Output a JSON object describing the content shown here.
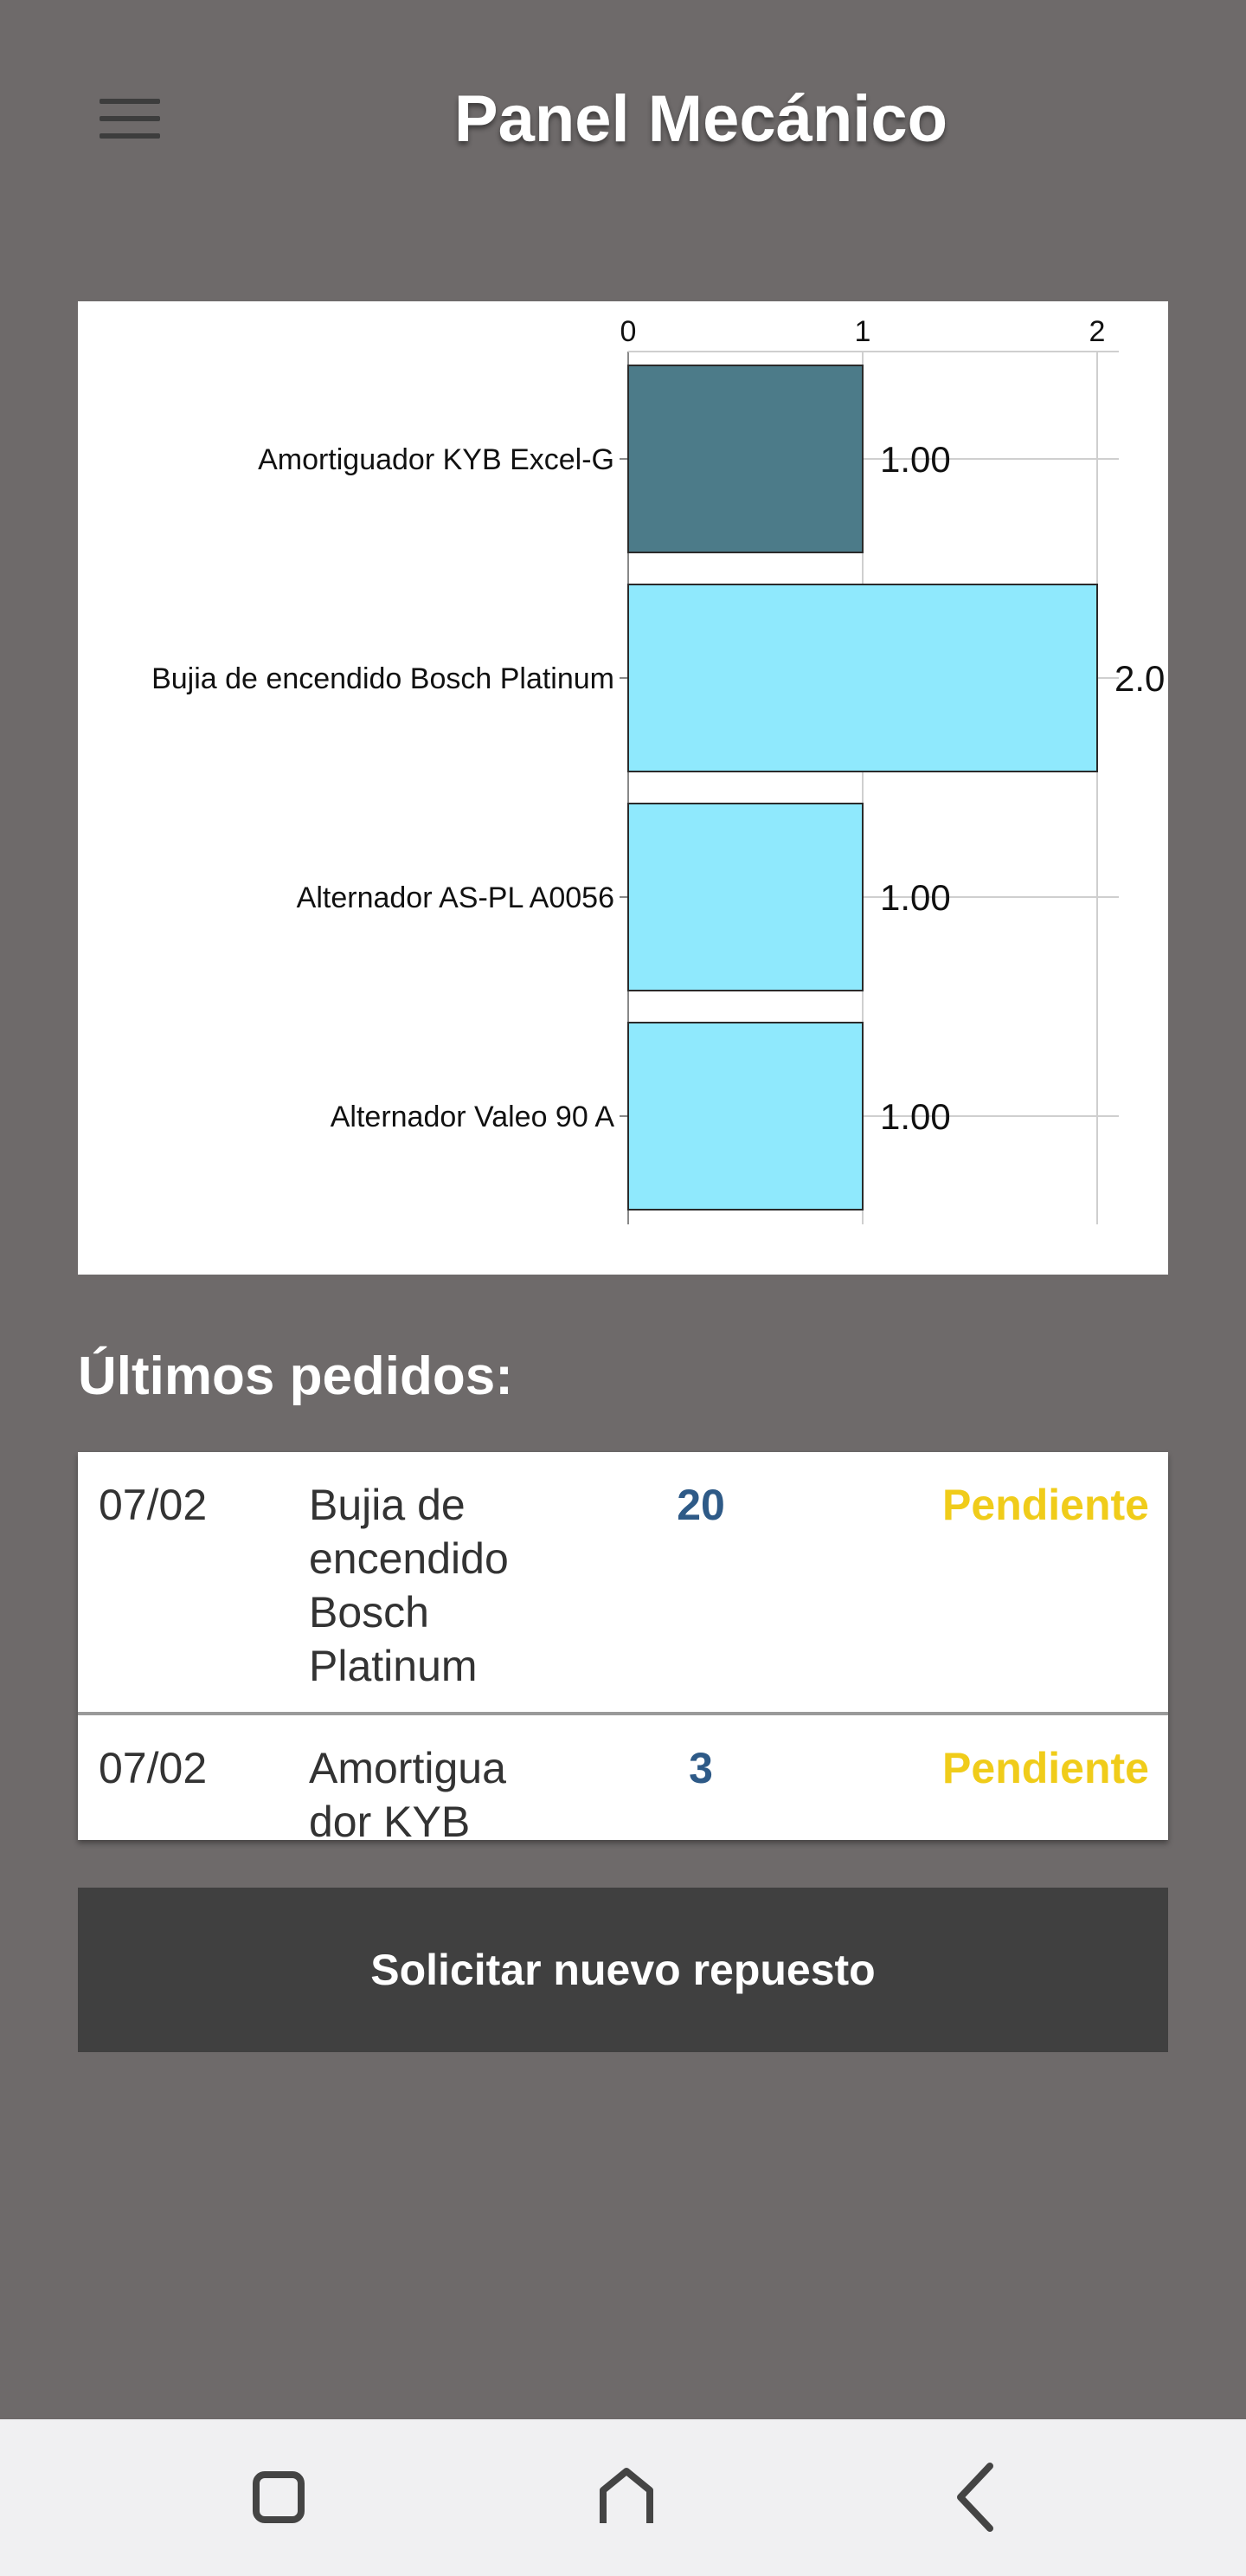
{
  "header": {
    "title": "Panel Mecánico",
    "menu_icon": "hamburger-menu-icon"
  },
  "chart_data": {
    "type": "bar",
    "orientation": "horizontal",
    "categories": [
      "Amortiguador KYB Excel-G",
      "Bujia de encendido Bosch Platinum",
      "Alternador AS-PL A0056",
      "Alternador Valeo 90 A"
    ],
    "values": [
      1,
      2,
      1,
      1
    ],
    "value_labels": [
      "1.00",
      "2.0",
      "1.00",
      "1.00"
    ],
    "colors": [
      "#4c7b89",
      "#8fe9fd",
      "#8fe9fd",
      "#8fe9fd"
    ],
    "xticks": [
      "0",
      "1",
      "2"
    ],
    "xlim": [
      0,
      2
    ],
    "x_axis_position": "top",
    "grid": true
  },
  "orders_section": {
    "title": "Últimos pedidos:",
    "rows": [
      {
        "date": "07/02",
        "product": "Bujia de encendido Bosch Platinum",
        "quantity": "20",
        "status": "Pendiente"
      },
      {
        "date": "07/02",
        "product": "Amortiguador KYB",
        "quantity": "3",
        "status": "Pendiente"
      }
    ]
  },
  "actions": {
    "request_label": "Solicitar nuevo repuesto"
  },
  "navbar": {
    "icons": [
      "recent-apps-icon",
      "home-icon",
      "back-icon"
    ]
  }
}
